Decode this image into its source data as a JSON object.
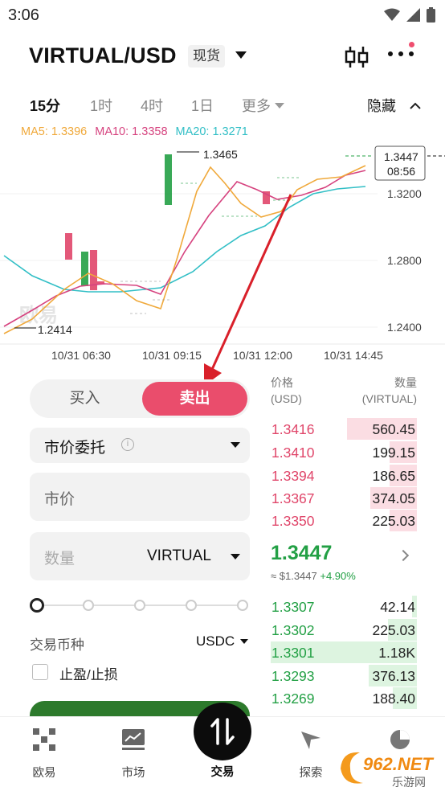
{
  "status_bar": {
    "time": "3:06"
  },
  "header": {
    "pair": "VIRTUAL/USD",
    "market_type": "现货"
  },
  "timeframes": {
    "items": [
      "15分",
      "1时",
      "4时",
      "1日"
    ],
    "active": "15分",
    "more": "更多",
    "hide": "隐藏"
  },
  "ma": {
    "ma5": "MA5: 1.3396",
    "ma10": "MA10: 1.3358",
    "ma20": "MA20: 1.3271"
  },
  "colors": {
    "ma5": "#f0a93b",
    "ma10": "#d6437f",
    "ma20": "#32bfc6",
    "up": "#23a045",
    "down": "#e0466a",
    "accent": "#ea4d6c"
  },
  "chart_data": {
    "type": "candlestick",
    "price_ticks": [
      "1.3200",
      "1.2800",
      "1.2400"
    ],
    "time_ticks": [
      "10/31 06:30",
      "10/31 09:15",
      "10/31 12:00",
      "10/31 14:45"
    ],
    "high_label": "1.3465",
    "low_label": "1.2414",
    "last_price_tag": "1.3447",
    "countdown": "08:56",
    "watermark": "欧易"
  },
  "trade": {
    "buy_label": "买入",
    "sell_label": "卖出",
    "order_type": "市价委托",
    "price_placeholder": "市价",
    "qty_placeholder": "数量",
    "qty_unit": "VIRTUAL",
    "coin_label": "交易币种",
    "coin_value": "USDC",
    "tpsl_label": "止盈/止损"
  },
  "orderbook": {
    "price_header": "价格",
    "price_unit": "(USD)",
    "qty_header": "数量",
    "qty_unit": "(VIRTUAL)",
    "asks": [
      {
        "price": "1.3416",
        "qty": "560.45"
      },
      {
        "price": "1.3410",
        "qty": "199.15"
      },
      {
        "price": "1.3394",
        "qty": "186.65"
      },
      {
        "price": "1.3367",
        "qty": "374.05"
      },
      {
        "price": "1.3350",
        "qty": "225.03"
      }
    ],
    "last_price": "1.3447",
    "last_usd": "≈ $1.3447",
    "last_change": "+4.90%",
    "bids": [
      {
        "price": "1.3307",
        "qty": "42.14"
      },
      {
        "price": "1.3302",
        "qty": "225.03"
      },
      {
        "price": "1.3301",
        "qty": "1.18K"
      },
      {
        "price": "1.3293",
        "qty": "376.13"
      },
      {
        "price": "1.3269",
        "qty": "188.40"
      }
    ]
  },
  "tabbar": {
    "items": [
      "欧易",
      "市场",
      "交易",
      "探索",
      ""
    ],
    "active": "交易"
  },
  "watermark": {
    "site": "962.NET",
    "sub": "乐游网"
  }
}
